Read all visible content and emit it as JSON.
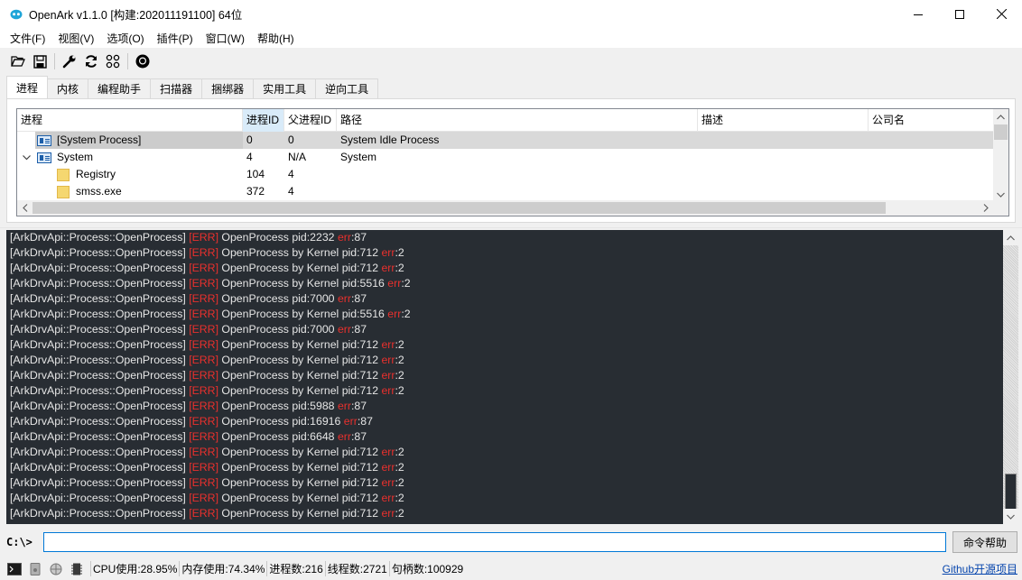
{
  "window": {
    "title": "OpenArk v1.1.0  [构建:202011191100]  64位"
  },
  "menu": [
    "文件(F)",
    "视图(V)",
    "选项(O)",
    "插件(P)",
    "窗口(W)",
    "帮助(H)"
  ],
  "tabs": [
    "进程",
    "内核",
    "编程助手",
    "扫描器",
    "捆绑器",
    "实用工具",
    "逆向工具"
  ],
  "active_tab": "进程",
  "table": {
    "columns": [
      "进程",
      "进程ID",
      "父进程ID",
      "路径",
      "描述",
      "公司名"
    ],
    "sorted_column": "进程ID",
    "rows": [
      {
        "name": "[System Process]",
        "pid": "0",
        "ppid": "0",
        "path": "System Idle Process",
        "desc": "",
        "company": "",
        "icon": "process-icon",
        "level": 1,
        "selected": true
      },
      {
        "name": "System",
        "pid": "4",
        "ppid": "N/A",
        "path": "System",
        "desc": "",
        "company": "",
        "icon": "process-icon",
        "level": 1,
        "expanded": true
      },
      {
        "name": "Registry",
        "pid": "104",
        "ppid": "4",
        "path": "",
        "desc": "",
        "company": "",
        "icon": "folder-icon",
        "level": 2
      },
      {
        "name": "smss.exe",
        "pid": "372",
        "ppid": "4",
        "path": "",
        "desc": "",
        "company": "",
        "icon": "folder-icon",
        "level": 2
      }
    ]
  },
  "console": {
    "lines": [
      {
        "prefix": "[ArkDrvApi::Process::OpenProcess]",
        "tag": "[ERR]",
        "msg": "OpenProcess pid:2232",
        "err_key": "err",
        "err_val": ":87"
      },
      {
        "prefix": "[ArkDrvApi::Process::OpenProcess]",
        "tag": "[ERR]",
        "msg": "OpenProcess by Kernel pid:712",
        "err_key": "err",
        "err_val": ":2"
      },
      {
        "prefix": "[ArkDrvApi::Process::OpenProcess]",
        "tag": "[ERR]",
        "msg": "OpenProcess by Kernel pid:712",
        "err_key": "err",
        "err_val": ":2"
      },
      {
        "prefix": "[ArkDrvApi::Process::OpenProcess]",
        "tag": "[ERR]",
        "msg": "OpenProcess by Kernel pid:5516",
        "err_key": "err",
        "err_val": ":2"
      },
      {
        "prefix": "[ArkDrvApi::Process::OpenProcess]",
        "tag": "[ERR]",
        "msg": "OpenProcess pid:7000",
        "err_key": "err",
        "err_val": ":87"
      },
      {
        "prefix": "[ArkDrvApi::Process::OpenProcess]",
        "tag": "[ERR]",
        "msg": "OpenProcess by Kernel pid:5516",
        "err_key": "err",
        "err_val": ":2"
      },
      {
        "prefix": "[ArkDrvApi::Process::OpenProcess]",
        "tag": "[ERR]",
        "msg": "OpenProcess pid:7000",
        "err_key": "err",
        "err_val": ":87"
      },
      {
        "prefix": "[ArkDrvApi::Process::OpenProcess]",
        "tag": "[ERR]",
        "msg": "OpenProcess by Kernel pid:712",
        "err_key": "err",
        "err_val": ":2"
      },
      {
        "prefix": "[ArkDrvApi::Process::OpenProcess]",
        "tag": "[ERR]",
        "msg": "OpenProcess by Kernel pid:712",
        "err_key": "err",
        "err_val": ":2"
      },
      {
        "prefix": "[ArkDrvApi::Process::OpenProcess]",
        "tag": "[ERR]",
        "msg": "OpenProcess by Kernel pid:712",
        "err_key": "err",
        "err_val": ":2"
      },
      {
        "prefix": "[ArkDrvApi::Process::OpenProcess]",
        "tag": "[ERR]",
        "msg": "OpenProcess by Kernel pid:712",
        "err_key": "err",
        "err_val": ":2"
      },
      {
        "prefix": "[ArkDrvApi::Process::OpenProcess]",
        "tag": "[ERR]",
        "msg": "OpenProcess pid:5988",
        "err_key": "err",
        "err_val": ":87"
      },
      {
        "prefix": "[ArkDrvApi::Process::OpenProcess]",
        "tag": "[ERR]",
        "msg": "OpenProcess pid:16916",
        "err_key": "err",
        "err_val": ":87"
      },
      {
        "prefix": "[ArkDrvApi::Process::OpenProcess]",
        "tag": "[ERR]",
        "msg": "OpenProcess pid:6648",
        "err_key": "err",
        "err_val": ":87"
      },
      {
        "prefix": "[ArkDrvApi::Process::OpenProcess]",
        "tag": "[ERR]",
        "msg": "OpenProcess by Kernel pid:712",
        "err_key": "err",
        "err_val": ":2"
      },
      {
        "prefix": "[ArkDrvApi::Process::OpenProcess]",
        "tag": "[ERR]",
        "msg": "OpenProcess by Kernel pid:712",
        "err_key": "err",
        "err_val": ":2"
      },
      {
        "prefix": "[ArkDrvApi::Process::OpenProcess]",
        "tag": "[ERR]",
        "msg": "OpenProcess by Kernel pid:712",
        "err_key": "err",
        "err_val": ":2"
      },
      {
        "prefix": "[ArkDrvApi::Process::OpenProcess]",
        "tag": "[ERR]",
        "msg": "OpenProcess by Kernel pid:712",
        "err_key": "err",
        "err_val": ":2"
      },
      {
        "prefix": "[ArkDrvApi::Process::OpenProcess]",
        "tag": "[ERR]",
        "msg": "OpenProcess by Kernel pid:712",
        "err_key": "err",
        "err_val": ":2"
      }
    ]
  },
  "command": {
    "prompt": "C:\\>",
    "value": "",
    "help_label": "命令帮助"
  },
  "status": {
    "cpu": "CPU使用:28.95%",
    "mem": "内存使用:74.34%",
    "processes": "进程数:216",
    "threads": "线程数:2721",
    "handles": "句柄数:100929",
    "link": "Github开源项目"
  },
  "colors": {
    "console_bg": "#282d33",
    "console_text": "#e6e6e6",
    "error": "#e8302d",
    "sorted_header": "#d9ebf9",
    "link": "#0645ad"
  }
}
